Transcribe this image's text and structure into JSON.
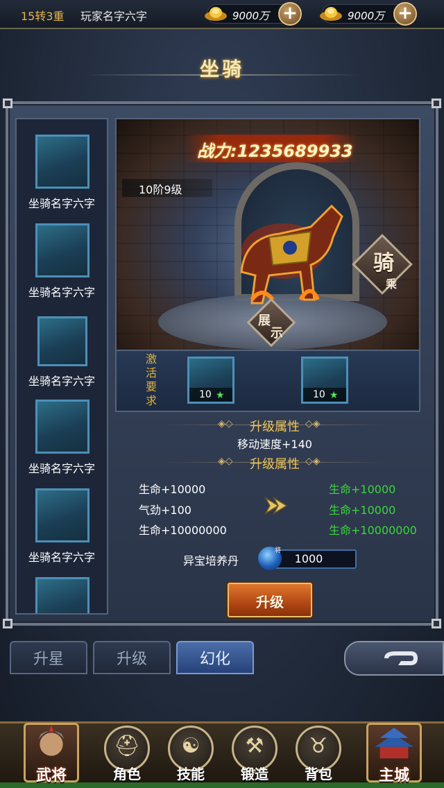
{
  "topbar": {
    "rank": "15转3重",
    "player_name": "玩家名字六字",
    "currencies": [
      {
        "value": "9000万",
        "icon": "gold-ingot-icon"
      },
      {
        "value": "9000万",
        "icon": "gold-ingot-icon"
      }
    ]
  },
  "title": "坐骑",
  "sidebar": {
    "items": [
      {
        "name": "坐骑名字六字"
      },
      {
        "name": "坐骑名字六字"
      },
      {
        "name": "坐骑名字六字"
      },
      {
        "name": "坐骑名字六字"
      },
      {
        "name": "坐骑名字六字"
      },
      {
        "name": ""
      }
    ]
  },
  "scene": {
    "power": "战力:1235689933",
    "level": "10阶9级",
    "ride_label_1": "骑",
    "ride_label_2": "乘",
    "show_label_1": "展",
    "show_label_2": "示"
  },
  "activate": {
    "label": "激活要求",
    "requirements": [
      {
        "count": "10"
      },
      {
        "count": "10"
      }
    ]
  },
  "attributes": {
    "section1_title": "升级属性",
    "speed": "移动速度+140",
    "section2_title": "升级属性",
    "current": [
      "生命+10000",
      "气劲+100",
      "生命+10000000"
    ],
    "next": [
      "生命+10000",
      "生命+10000",
      "生命+10000000"
    ],
    "next_color": "#3ad63a"
  },
  "material": {
    "name": "异宝培养丹",
    "badge": "将",
    "quantity": "1000"
  },
  "upgrade_button": "升级",
  "tabs": [
    {
      "label": "升星"
    },
    {
      "label": "升级"
    },
    {
      "label": "幻化",
      "active": true
    }
  ],
  "nav": [
    {
      "label": "武将"
    },
    {
      "label": "角色",
      "icon": "helmet-icon"
    },
    {
      "label": "技能",
      "icon": "swirl-icon"
    },
    {
      "label": "锻造",
      "icon": "anvil-icon"
    },
    {
      "label": "背包",
      "icon": "bag-icon"
    },
    {
      "label": "主城"
    }
  ]
}
